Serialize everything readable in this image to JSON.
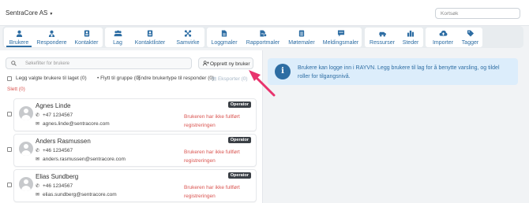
{
  "header": {
    "company": "SentraCore AS",
    "quicksearch_placeholder": "Kortsøk"
  },
  "nav": [
    {
      "label": "Brukere",
      "icon": "user-icon",
      "active": true
    },
    {
      "label": "Respondere",
      "icon": "responder-icon"
    },
    {
      "label": "Kontakter",
      "icon": "contact-card-icon"
    },
    {
      "label": "Lag",
      "icon": "team-icon"
    },
    {
      "label": "Kontaktlister",
      "icon": "contact-list-icon"
    },
    {
      "label": "Samvirke",
      "icon": "network-icon"
    },
    {
      "label": "Loggmaler",
      "icon": "log-template-icon"
    },
    {
      "label": "Rapportmaler",
      "icon": "report-template-icon"
    },
    {
      "label": "Møtemaler",
      "icon": "meeting-template-icon"
    },
    {
      "label": "Meldingsmaler",
      "icon": "message-template-icon"
    },
    {
      "label": "Ressurser",
      "icon": "resources-icon"
    },
    {
      "label": "Steder",
      "icon": "places-icon"
    },
    {
      "label": "Importer",
      "icon": "cloud-upload-icon"
    },
    {
      "label": "Tagger",
      "icon": "tags-icon"
    }
  ],
  "toolbar": {
    "search_placeholder": "Søkefilter for brukere",
    "new_user_label": "Opprett ny bruker"
  },
  "bulk": {
    "add_to_team": "Legg valgte brukere til laget (0)",
    "move_to_group": "• Flytt til gruppe (0)",
    "change_type": "Endre brukertype til responder (0)",
    "export": "Eksporter (0)",
    "delete": "Slett (0)"
  },
  "users": [
    {
      "name": "Agnes Linde",
      "phone": "+47 1234567",
      "email": "agnes.linde@sentracore.com",
      "role": "Operator",
      "warning": "Brukeren har ikke fullført registreringen"
    },
    {
      "name": "Anders Rasmussen",
      "phone": "+46 1234567",
      "email": "anders.rasmussen@sentracore.com",
      "role": "Operator",
      "warning": "Brukeren har ikke fullført registreringen"
    },
    {
      "name": "Elias Sundberg",
      "phone": "+46 1234567",
      "email": "elias.sundberg@sentracore.com",
      "role": "Operator",
      "warning": "Brukeren har ikke fullført registreringen"
    }
  ],
  "info": {
    "text": "Brukere kan logge inn i RAYVN. Legg brukere til lag for å benytte varsling, og tildel roller for tilgangsnivå."
  },
  "colors": {
    "accent": "#2d6da3",
    "warning": "#d9534f",
    "annotation_arrow": "#e8336d",
    "info_bg": "#dcedfb"
  }
}
